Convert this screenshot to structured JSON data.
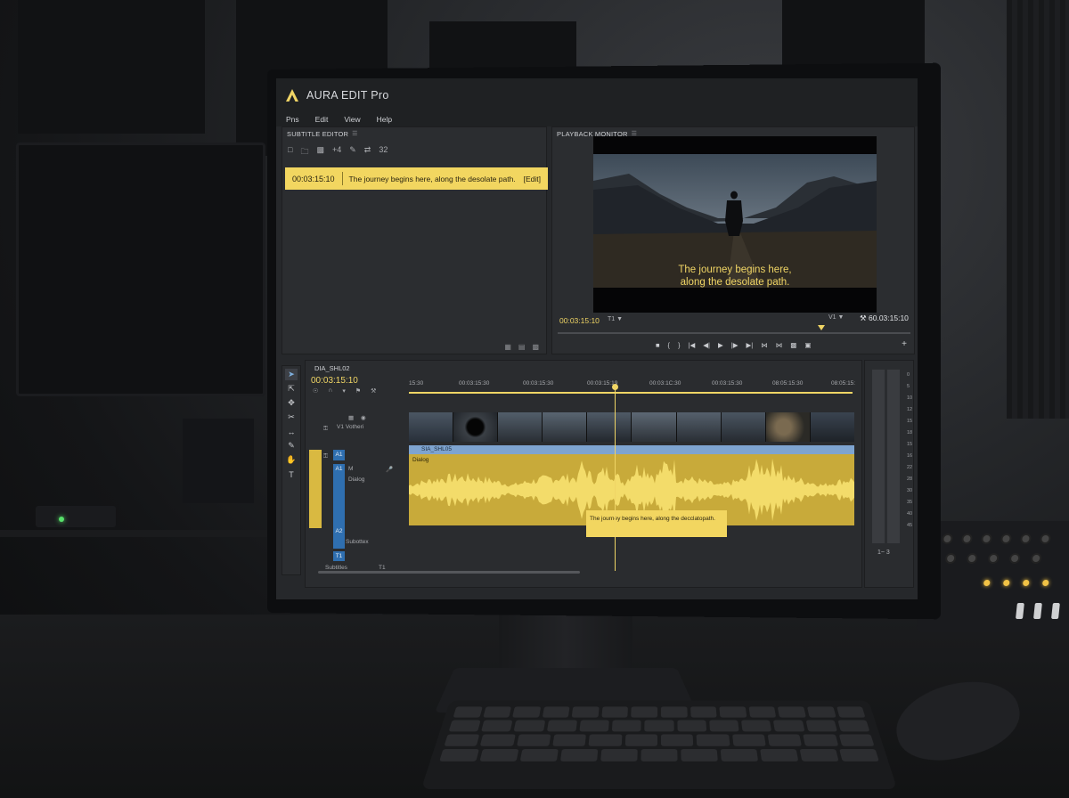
{
  "app": {
    "title": "AURA EDIT Pro",
    "accent_color": "#f0d565",
    "menu": [
      "Pns",
      "Edit",
      "View",
      "Help"
    ]
  },
  "subtitle_editor": {
    "header": "SUBTITLE EDITOR",
    "toolbar_icons": [
      "new-file-icon",
      "folder-icon",
      "trash-icon",
      "add-icon",
      "pen-icon",
      "shuffle-icon",
      "sort-icon"
    ],
    "toolbar_glyphs": {
      "add": "+4",
      "sort": "32"
    },
    "entries": [
      {
        "timecode": "00:03:15:10",
        "text": "The journey begins here, along the desolate path.",
        "action": "[Edit]"
      }
    ]
  },
  "playback_monitor": {
    "header": "PLAYBACK MONITOR",
    "caption_line1": "The journey begins here,",
    "caption_line2": "along the desolate path.",
    "timecode_left": "00:03:15:10",
    "track_left": "T1",
    "track_right": "V1",
    "timecode_right": "60.03:15:10"
  },
  "timeline": {
    "sequence_name": "DIA_SHL02",
    "timecode": "00:03:15:10",
    "ruler_labels": [
      "15:30",
      "00:03:15:30",
      "00:03:15:30",
      "00:03:15:19",
      "00:03:1C:30",
      "00:03:15:30",
      "08:05:15:30",
      "08:05:15:"
    ],
    "tracks": {
      "v1_label": "V1",
      "v1_name": "Votheri",
      "a1_label": "A1",
      "a1_clip_name": "SIA_SHL05",
      "audio_label": "Dialog",
      "a2_label": "A2",
      "a2_name": "Subottex",
      "t1_label": "T1",
      "subtitles_name": "Subtitles",
      "subtitle_clip_text": "The journey begins here, along the decclatopath."
    }
  },
  "meters": {
    "scale": [
      "0",
      "5",
      "10",
      "12",
      "15",
      "18",
      "15",
      "16",
      "22",
      "28",
      "30",
      "35",
      "40",
      "45"
    ],
    "footer": "1~ 3"
  }
}
